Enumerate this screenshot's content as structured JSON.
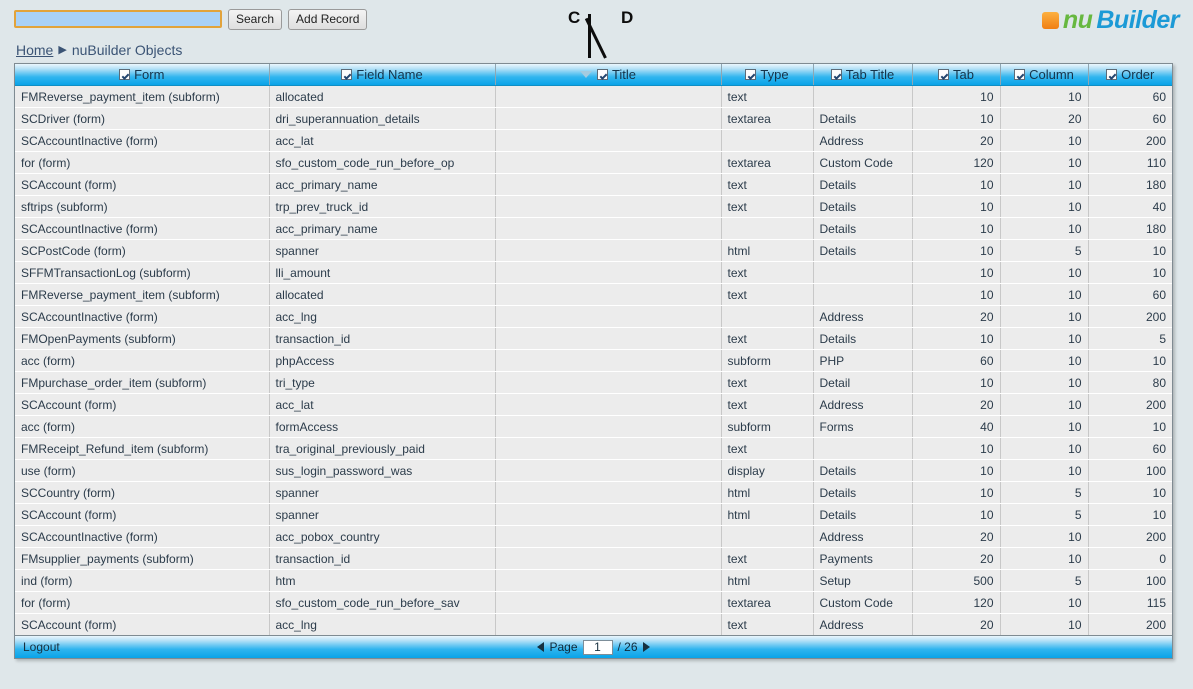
{
  "toolbar": {
    "search_value": "",
    "search_placeholder": "",
    "search_label": "Search",
    "add_record_label": "Add Record"
  },
  "breadcrumb": {
    "home_label": "Home",
    "separator": "▶",
    "current_label": "nuBuilder Objects"
  },
  "logo": {
    "nu": "nu",
    "builder": "Builder",
    "square_color": "#f29020",
    "nu_color": "#67b840",
    "builder_color": "#1c9ad6"
  },
  "annotations": [
    {
      "letter": "C"
    },
    {
      "letter": "D"
    }
  ],
  "grid": {
    "columns": [
      {
        "label": "Form",
        "checked": true,
        "sorted": false,
        "align": "left"
      },
      {
        "label": "Field Name",
        "checked": true,
        "sorted": false,
        "align": "left"
      },
      {
        "label": "Title",
        "checked": true,
        "sorted": true,
        "align": "left"
      },
      {
        "label": "Type",
        "checked": true,
        "sorted": false,
        "align": "left"
      },
      {
        "label": "Tab Title",
        "checked": true,
        "sorted": false,
        "align": "left"
      },
      {
        "label": "Tab",
        "checked": true,
        "sorted": false,
        "align": "right"
      },
      {
        "label": "Column",
        "checked": true,
        "sorted": false,
        "align": "right"
      },
      {
        "label": "Order",
        "checked": true,
        "sorted": false,
        "align": "right"
      }
    ],
    "rows": [
      [
        "FMReverse_payment_item (subform)",
        "allocated",
        "",
        "text",
        "",
        "10",
        "10",
        "60"
      ],
      [
        "SCDriver (form)",
        "dri_superannuation_details",
        "",
        "textarea",
        "Details",
        "10",
        "20",
        "60"
      ],
      [
        "SCAccountInactive (form)",
        "acc_lat",
        "",
        "",
        "Address",
        "20",
        "10",
        "200"
      ],
      [
        "for (form)",
        "sfo_custom_code_run_before_op",
        "",
        "textarea",
        "Custom Code",
        "120",
        "10",
        "110"
      ],
      [
        "SCAccount (form)",
        "acc_primary_name",
        "",
        "text",
        "Details",
        "10",
        "10",
        "180"
      ],
      [
        "sftrips (subform)",
        "trp_prev_truck_id",
        "",
        "text",
        "Details",
        "10",
        "10",
        "40"
      ],
      [
        "SCAccountInactive (form)",
        "acc_primary_name",
        "",
        "",
        "Details",
        "10",
        "10",
        "180"
      ],
      [
        "SCPostCode (form)",
        "spanner",
        "",
        "html",
        "Details",
        "10",
        "5",
        "10"
      ],
      [
        "SFFMTransactionLog (subform)",
        "lli_amount",
        "",
        "text",
        "",
        "10",
        "10",
        "10"
      ],
      [
        "FMReverse_payment_item (subform)",
        "allocated",
        "",
        "text",
        "",
        "10",
        "10",
        "60"
      ],
      [
        "SCAccountInactive (form)",
        "acc_lng",
        "",
        "",
        "Address",
        "20",
        "10",
        "200"
      ],
      [
        "FMOpenPayments (subform)",
        "transaction_id",
        "",
        "text",
        "Details",
        "10",
        "10",
        "5"
      ],
      [
        "acc (form)",
        "phpAccess",
        "",
        "subform",
        "PHP",
        "60",
        "10",
        "10"
      ],
      [
        "FMpurchase_order_item (subform)",
        "tri_type",
        "",
        "text",
        "Detail",
        "10",
        "10",
        "80"
      ],
      [
        "SCAccount (form)",
        "acc_lat",
        "",
        "text",
        "Address",
        "20",
        "10",
        "200"
      ],
      [
        "acc (form)",
        "formAccess",
        "",
        "subform",
        "Forms",
        "40",
        "10",
        "10"
      ],
      [
        "FMReceipt_Refund_item (subform)",
        "tra_original_previously_paid",
        "",
        "text",
        "",
        "10",
        "10",
        "60"
      ],
      [
        "use (form)",
        "sus_login_password_was",
        "",
        "display",
        "Details",
        "10",
        "10",
        "100"
      ],
      [
        "SCCountry (form)",
        "spanner",
        "",
        "html",
        "Details",
        "10",
        "5",
        "10"
      ],
      [
        "SCAccount (form)",
        "spanner",
        "",
        "html",
        "Details",
        "10",
        "5",
        "10"
      ],
      [
        "SCAccountInactive (form)",
        "acc_pobox_country",
        "",
        "",
        "Address",
        "20",
        "10",
        "200"
      ],
      [
        "FMsupplier_payments (subform)",
        "transaction_id",
        "",
        "text",
        "Payments",
        "20",
        "10",
        "0"
      ],
      [
        "ind (form)",
        "htm",
        "",
        "html",
        "Setup",
        "500",
        "5",
        "100"
      ],
      [
        "for (form)",
        "sfo_custom_code_run_before_sav",
        "",
        "textarea",
        "Custom Code",
        "120",
        "10",
        "115"
      ],
      [
        "SCAccount (form)",
        "acc_lng",
        "",
        "text",
        "Address",
        "20",
        "10",
        "200"
      ]
    ]
  },
  "footer": {
    "logout_label": "Logout",
    "page_label": "Page",
    "page_value": "1",
    "total_pages": "/ 26",
    "prev_icon": "triangle-left-icon",
    "next_icon": "triangle-right-icon"
  }
}
